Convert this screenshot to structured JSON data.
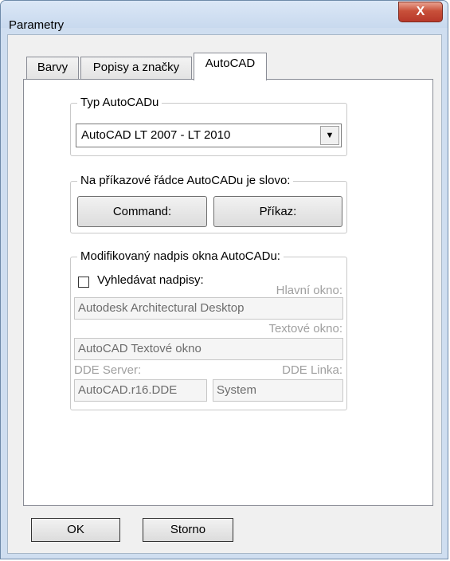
{
  "window": {
    "title": "Parametry",
    "close_glyph": "X"
  },
  "tabs": [
    "Barvy",
    "Popisy a značky",
    "AutoCAD"
  ],
  "active_tab": "AutoCAD",
  "typ_group": {
    "label": "Typ AutoCADu",
    "selected": "AutoCAD LT 2007 - LT 2010",
    "arrow_glyph": "▼"
  },
  "prikaz_group": {
    "label": "Na příkazové řádce AutoCADu je slovo:",
    "option1": "Command:",
    "option2": "Příkaz:"
  },
  "nadpis_group": {
    "label": "Modifikovaný nadpis okna AutoCADu:",
    "checkbox_label": "Vyhledávat nadpisy:",
    "checked": false,
    "hlavni_label": "Hlavní okno:",
    "hlavni_value": "Autodesk Architectural Desktop",
    "textove_label": "Textové okno:",
    "textove_value": "AutoCAD Textové okno",
    "dde_server_label": "DDE Server:",
    "dde_server_value": "AutoCAD.r16.DDE",
    "dde_linka_label": "DDE Linka:",
    "dde_linka_value": "System"
  },
  "buttons": {
    "ok": "OK",
    "cancel": "Storno"
  }
}
